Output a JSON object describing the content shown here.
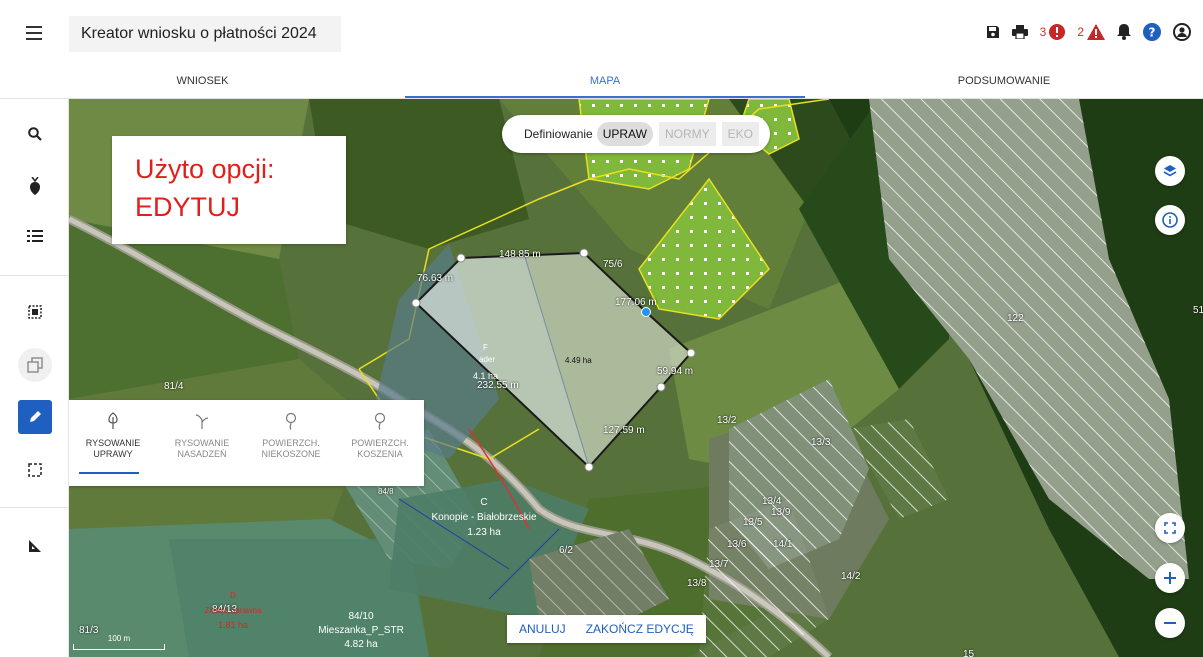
{
  "header": {
    "app_title": "Kreator wniosku o płatności 2024",
    "error_count": "3",
    "warning_count": "2"
  },
  "tabs": [
    {
      "label": "WNIOSEK",
      "active": false
    },
    {
      "label": "MAPA",
      "active": true
    },
    {
      "label": "PODSUMOWANIE",
      "active": false
    }
  ],
  "left_toolbar": [
    "search-icon",
    "pin-icon",
    "list-icon",
    "select-icon",
    "copy-icon",
    "edit-icon",
    "frame-icon",
    "measure-icon"
  ],
  "notice": {
    "line1": "Użyto opcji:",
    "line2": "EDYTUJ"
  },
  "definiowanie": {
    "label": "Definiowanie",
    "options": [
      "UPRAW",
      "NORMY",
      "EKO"
    ],
    "selected": "UPRAW"
  },
  "draw_panel": [
    {
      "line1": "RYSOWANIE",
      "line2": "UPRAWY",
      "active": true
    },
    {
      "line1": "RYSOWANIE",
      "line2": "NASADZEŃ",
      "active": false
    },
    {
      "line1": "POWIERZCH.",
      "line2": "NIEKOSZONE",
      "active": false
    },
    {
      "line1": "POWIERZCH.",
      "line2": "KOSZENIA",
      "active": false
    }
  ],
  "map_actions": {
    "cancel": "ANULUJ",
    "finish": "ZAKOŃCZ EDYCJĘ"
  },
  "scale_label": "100 m",
  "measurements": {
    "top": "148.85 m",
    "left": "76.63 m",
    "right_diag": "177.06 m",
    "right": "59.94 m",
    "bottom_left": "232.55 m",
    "bottom_right": "127.59 m"
  },
  "map_labels": {
    "area_inside": "4.49 ha",
    "area_f": "4.1 ha",
    "letter_f": "F",
    "crop_f": "ader",
    "parcel_75_6": "75/6",
    "parcel_81_4": "81/4",
    "parcel_13_2": "13/2",
    "parcel_13_3": "13/3",
    "parcel_13_4": "13/4",
    "parcel_13_5": "13/5",
    "parcel_13_6": "13/6",
    "parcel_13_7": "13/7",
    "parcel_13_8": "13/8",
    "parcel_13_9": "13/9",
    "parcel_14_1": "14/1",
    "parcel_14_2": "14/2",
    "parcel_6_2": "6/2",
    "parcel_122": "122",
    "parcel_15": "15",
    "parcel_81_3": "81/3",
    "parcel_84_10": "84/10",
    "parcel_84_13": "84/13",
    "parcel_51": "51",
    "parcel_84_8": "84/8",
    "field_c_letter": "C",
    "field_c_crop": "Konopie - Białobrzeskie",
    "field_c_area": "1.23 ha",
    "field_d_letter": "D",
    "field_d_crop": "Ziemia uprawna",
    "field_d_area": "1.81 ha",
    "field_84_crop": "Mieszanka_P_STR",
    "field_84_area": "4.82 ha"
  },
  "colors": {
    "accent": "#1f5fbf",
    "error": "#d32f2f",
    "notice_text": "#e0201b"
  }
}
